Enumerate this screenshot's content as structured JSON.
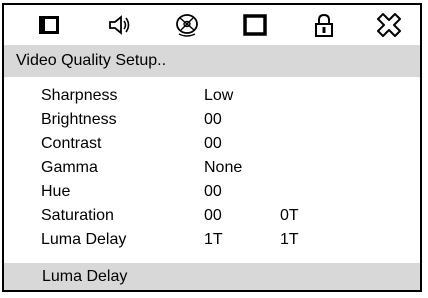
{
  "toolbar": {
    "icons": [
      "monitor-icon",
      "speaker-icon",
      "disc-icon",
      "video-icon",
      "lock-icon",
      "close-icon"
    ]
  },
  "header": {
    "title": "Video Quality Setup.."
  },
  "settings": [
    {
      "label": "Sharpness",
      "value": "Low",
      "value2": ""
    },
    {
      "label": "Brightness",
      "value": "00",
      "value2": ""
    },
    {
      "label": "Contrast",
      "value": "00",
      "value2": ""
    },
    {
      "label": "Gamma",
      "value": "None",
      "value2": ""
    },
    {
      "label": "Hue",
      "value": "00",
      "value2": ""
    },
    {
      "label": "Saturation",
      "value": "00",
      "value2": "0T"
    },
    {
      "label": "Luma Delay",
      "value": "1T",
      "value2": "1T"
    }
  ],
  "footer": {
    "help_text": "Luma Delay"
  }
}
